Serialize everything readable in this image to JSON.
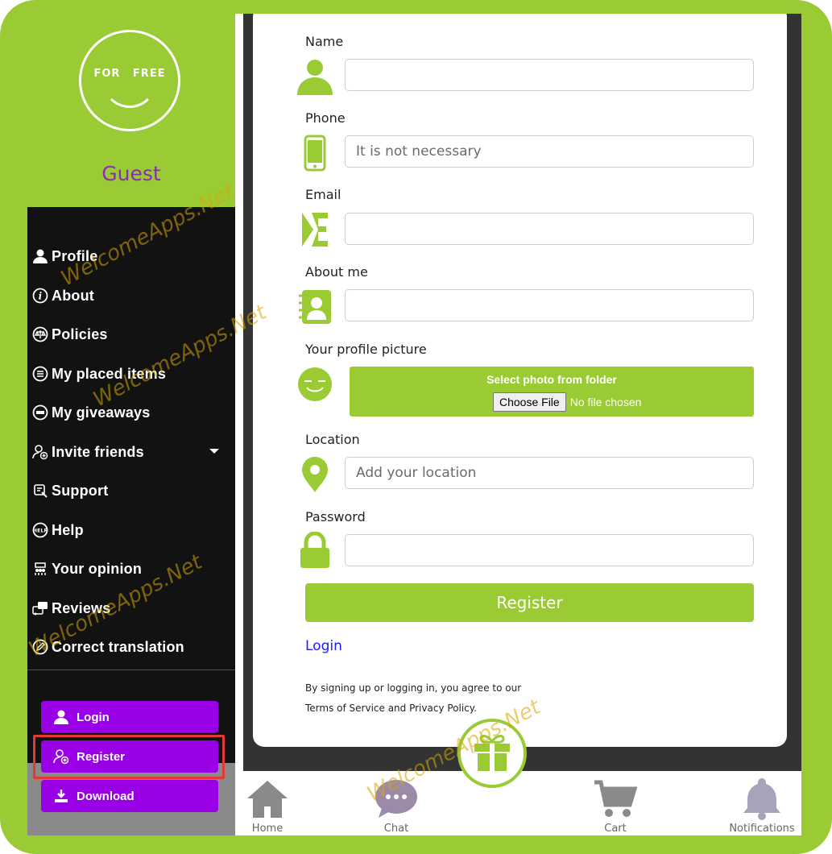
{
  "colors": {
    "brand_green": "#9acb34",
    "purple_button": "#9900e6",
    "guest_text": "#8b2bb8",
    "sidebar_bg": "#121212",
    "highlight_border": "#e53935",
    "link_blue": "#1a1aff"
  },
  "logo": {
    "text": "FOR  FREE"
  },
  "sidebar": {
    "user_name": "Guest",
    "menu": [
      {
        "label": "Profile",
        "icon": "user-icon"
      },
      {
        "label": "About",
        "icon": "info-icon"
      },
      {
        "label": "Policies",
        "icon": "scales-icon"
      },
      {
        "label": "My placed items",
        "icon": "list-icon"
      },
      {
        "label": "My giveaways",
        "icon": "gift-badge-icon"
      },
      {
        "label": "Invite friends",
        "icon": "user-plus-icon"
      },
      {
        "label": "Support",
        "icon": "support-icon"
      },
      {
        "label": "Help",
        "icon": "help-icon"
      },
      {
        "label": "Your opinion",
        "icon": "opinion-icon"
      },
      {
        "label": "Reviews",
        "icon": "reviews-icon"
      },
      {
        "label": "Correct translation",
        "icon": "pencil-circle-icon"
      }
    ],
    "auth_buttons": [
      {
        "label": "Login",
        "icon": "user-icon"
      },
      {
        "label": "Register",
        "icon": "user-plus-icon"
      },
      {
        "label": "Download",
        "icon": "download-icon"
      }
    ]
  },
  "form": {
    "name_label": "Name",
    "phone_label": "Phone",
    "phone_placeholder": "It is not necessary",
    "email_label": "Email",
    "about_label": "About me",
    "picture_label": "Your profile picture",
    "picture_button_title": "Select photo from folder",
    "choose_file": "Choose File",
    "no_file": "No file chosen",
    "location_label": "Location",
    "location_placeholder": "Add your location",
    "password_label": "Password",
    "register_button": "Register",
    "login_link": "Login",
    "terms_line1": "By signing up or logging in, you agree to our",
    "terms_line2": "Terms of Service and Privacy Policy."
  },
  "bottom_nav": [
    {
      "label": "Home",
      "icon": "home-icon"
    },
    {
      "label": "Chat",
      "icon": "chat-icon"
    },
    {
      "label": "Cart",
      "icon": "cart-icon"
    },
    {
      "label": "Notifications",
      "icon": "bell-icon"
    }
  ],
  "watermark": "WelcomeApps.Net"
}
